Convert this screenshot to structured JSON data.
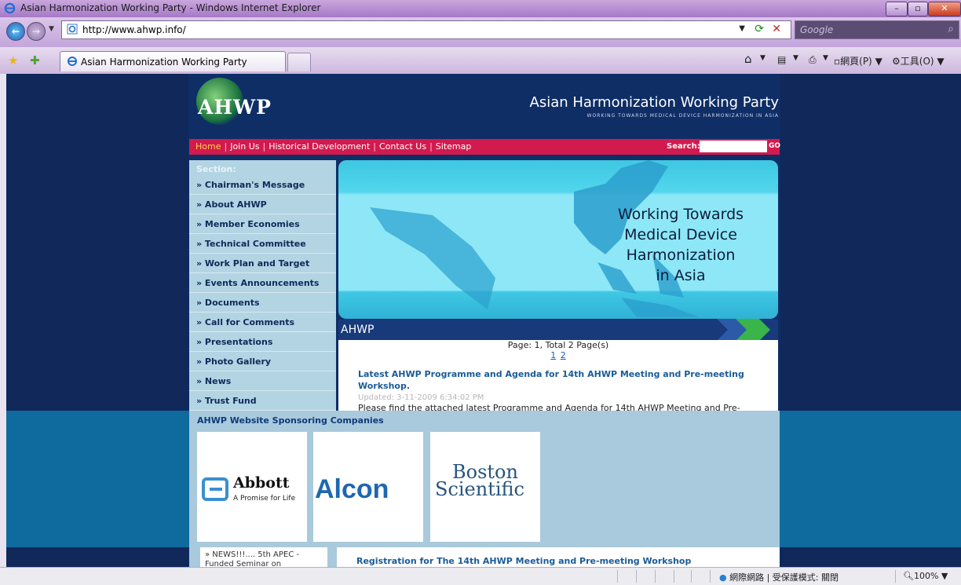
{
  "window": {
    "title": "Asian Harmonization Working Party - Windows Internet Explorer"
  },
  "address": {
    "url": "http://www.ahwp.info/",
    "search_placeholder": "Google"
  },
  "tabs": [
    {
      "label": "Asian Harmonization Working Party"
    }
  ],
  "toolbar": {
    "page_label": "網頁(P)",
    "tools_label": "工具(O)"
  },
  "header": {
    "logo": "AHWP",
    "org_name": "Asian Harmonization Working Party",
    "tagline": "WORKING TOWARDS MEDICAL DEVICE HARMONIZATION IN ASIA"
  },
  "menu": {
    "items": [
      "Home",
      "Join Us",
      "Historical Development",
      "Contact Us",
      "Sitemap"
    ],
    "search_label": "Search:",
    "go_label": "GO"
  },
  "sidebar": {
    "section_label": "Section:",
    "items": [
      "» Chairman's Message",
      "» About AHWP",
      "» Member Economies",
      "» Technical Committee",
      "» Work Plan and Target",
      "» Events Announcements",
      "» Documents",
      "» Call for Comments",
      "» Presentations",
      "» Photo Gallery",
      "» News",
      "» Trust Fund"
    ]
  },
  "banner": {
    "line1": "Working Towards",
    "line2": "Medical Device",
    "line3": "Harmonization",
    "line4": "in Asia"
  },
  "section": {
    "title": "AHWP"
  },
  "pagination": {
    "info": "Page: 1, Total 2 Page(s)",
    "pages": [
      "1",
      "2"
    ]
  },
  "news": [
    {
      "title": "Latest AHWP Programme and Agenda for 14th AHWP Meeting and Pre-meeting Workshop.",
      "updated": "Updated: 3-11-2009 6:34:02 PM",
      "desc": "Please find the attached latest Programme and Agenda for 14th AHWP Meeting and Pre-"
    },
    {
      "title": "Registration for The 14th AHWP Meeting and Pre-meeting Workshop"
    }
  ],
  "sponsors": {
    "title": "AHWP Website Sponsoring Companies",
    "items": [
      {
        "name": "Abbott",
        "tagline": "A Promise for Life"
      },
      {
        "name": "Alcon"
      },
      {
        "name_line1": "Boston",
        "name_line2": "Scientific"
      }
    ]
  },
  "lower": {
    "news_ticker": "» NEWS!!!.... 5th APEC -\nFunded Seminar on"
  },
  "status": {
    "zone": "網際網路 | 受保護模式: 關閉",
    "zoom": "100%"
  },
  "colors": {
    "menu_red": "#d31a4e",
    "page_navy": "#10285a",
    "link_blue": "#1a5b98"
  }
}
